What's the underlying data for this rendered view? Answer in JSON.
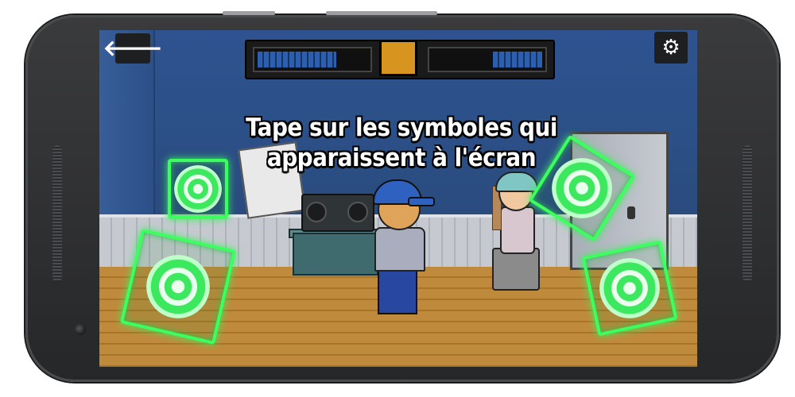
{
  "hud": {
    "back_icon": "arrow-left-icon",
    "settings_icon": "gear-icon",
    "meter": {
      "left_level": 0.72,
      "right_level": 0.45,
      "bar_color": "#2c5fb0",
      "center_color": "#d7951f"
    }
  },
  "instruction": {
    "line1": "Tape sur les symboles qui",
    "line2": "apparaissent à l'écran"
  },
  "targets": {
    "color": "#3bff5e",
    "icon": "concentric-circle-icon",
    "count": 4
  },
  "glyphs": {
    "back": "🡐",
    "gear": "⚙"
  }
}
